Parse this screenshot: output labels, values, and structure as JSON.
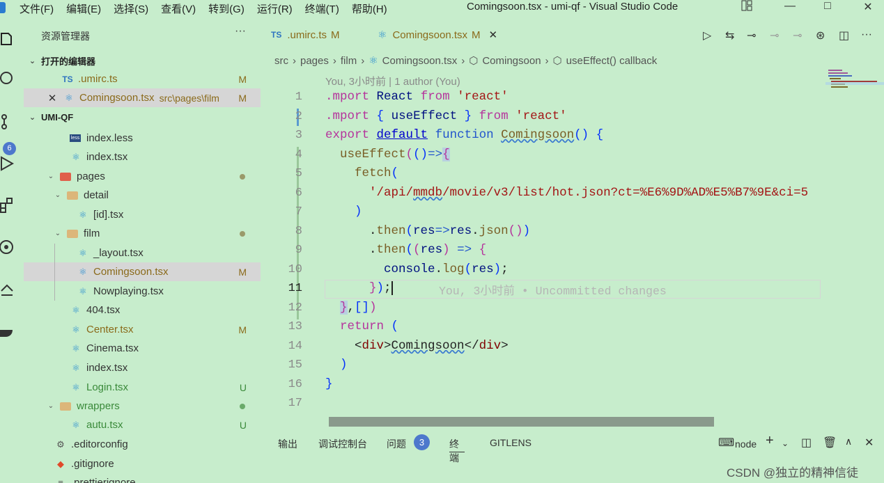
{
  "menu": [
    "文件(F)",
    "编辑(E)",
    "选择(S)",
    "查看(V)",
    "转到(G)",
    "运行(R)",
    "终端(T)",
    "帮助(H)"
  ],
  "window_title": "Comingsoon.tsx - umi-qf - Visual Studio Code",
  "activity_badge": "6",
  "explorer": {
    "title": "资源管理器",
    "more": "···",
    "open_editors_label": "打开的编辑器",
    "open_editors": [
      {
        "name": ".umirc.ts",
        "status": "M"
      },
      {
        "name": "Comingsoon.tsx",
        "path": "src\\pages\\film",
        "status": "M"
      }
    ],
    "workspace_label": "UMI-QF",
    "tree": [
      {
        "name": "index.less"
      },
      {
        "name": "index.tsx"
      },
      {
        "name": "pages"
      },
      {
        "name": "detail"
      },
      {
        "name": "[id].tsx"
      },
      {
        "name": "film"
      },
      {
        "name": "_layout.tsx"
      },
      {
        "name": "Comingsoon.tsx",
        "status": "M"
      },
      {
        "name": "Nowplaying.tsx"
      },
      {
        "name": "404.tsx"
      },
      {
        "name": "Center.tsx",
        "status": "M"
      },
      {
        "name": "Cinema.tsx"
      },
      {
        "name": "index.tsx"
      },
      {
        "name": "Login.tsx",
        "status": "U"
      },
      {
        "name": "wrappers"
      },
      {
        "name": "autu.tsx",
        "status": "U"
      },
      {
        "name": ".editorconfig"
      },
      {
        "name": ".gitignore"
      },
      {
        "name": ".prettierignore"
      }
    ]
  },
  "tabs": [
    {
      "icon": "TS",
      "name": ".umirc.ts",
      "status": "M"
    },
    {
      "name": "Comingsoon.tsx",
      "status": "M",
      "close": "✕"
    }
  ],
  "breadcrumb": [
    "src",
    "pages",
    "film",
    "Comingsoon.tsx",
    "Comingsoon",
    "useEffect() callback"
  ],
  "blame_header": "You, 3小时前 | 1 author (You)",
  "inline_blame": "You, 3小时前 • Uncommitted changes",
  "line_numbers": [
    "1",
    "2",
    "3",
    "4",
    "5",
    "6",
    "7",
    "8",
    "9",
    "10",
    "11",
    "12",
    "13",
    "14",
    "15",
    "16",
    "17"
  ],
  "panel": {
    "tabs": [
      "输出",
      "调试控制台",
      "问题",
      "终端",
      "GITLENS"
    ],
    "problems_count": "3",
    "terminal_name": "node"
  },
  "watermark": "CSDN @独立的精神信徒"
}
